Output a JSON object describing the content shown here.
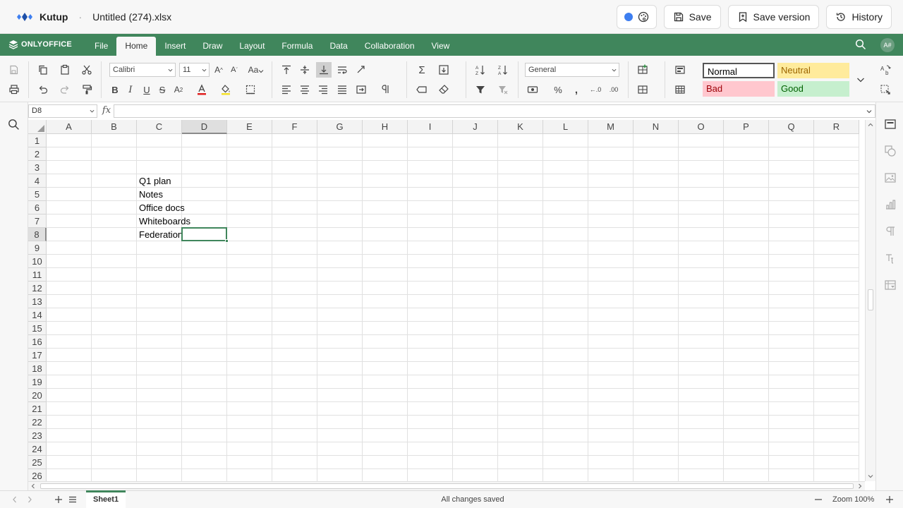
{
  "app": {
    "brand": "Kutup",
    "separator": "·",
    "doc_title": "Untitled (274).xlsx",
    "save_label": "Save",
    "save_version_label": "Save version",
    "history_label": "History"
  },
  "editor": {
    "logo_text": "ONLYOFFICE",
    "avatar_initials": "A#",
    "tabs": [
      "File",
      "Home",
      "Insert",
      "Draw",
      "Layout",
      "Formula",
      "Data",
      "Collaboration",
      "View"
    ],
    "active_tab": "Home"
  },
  "toolbar": {
    "font_name": "Calibri",
    "font_size": "11",
    "number_format": "General",
    "styles": {
      "normal": "Normal",
      "neutral": "Neutral",
      "bad": "Bad",
      "good": "Good"
    },
    "style_colors": {
      "neutral_bg": "#ffeb9c",
      "neutral_fg": "#9c6500",
      "bad_bg": "#ffc7ce",
      "bad_fg": "#9c0006",
      "good_bg": "#c6efce",
      "good_fg": "#006100"
    }
  },
  "formula_bar": {
    "name_box": "D8",
    "fx": "fx",
    "value": ""
  },
  "sheet": {
    "columns": [
      "A",
      "B",
      "C",
      "D",
      "E",
      "F",
      "G",
      "H",
      "I",
      "J",
      "K",
      "L",
      "M",
      "N",
      "O",
      "P",
      "Q",
      "R"
    ],
    "rows": [
      "1",
      "2",
      "3",
      "4",
      "5",
      "6",
      "7",
      "8",
      "9",
      "10",
      "11",
      "12",
      "13",
      "14",
      "15",
      "16",
      "17",
      "18",
      "19",
      "20",
      "21",
      "22",
      "23",
      "24",
      "25",
      "26"
    ],
    "selected_cell": "D8",
    "cells": {
      "C4": "Q1 plan",
      "C5": "Notes",
      "C6": "Office docs",
      "C7": "Whiteboards",
      "C8": "Federation"
    }
  },
  "status": {
    "sheet_name": "Sheet1",
    "message": "All changes saved",
    "zoom": "Zoom 100%"
  },
  "colors": {
    "accent_green": "#40865c",
    "save_dot": "#3d7ef0"
  }
}
